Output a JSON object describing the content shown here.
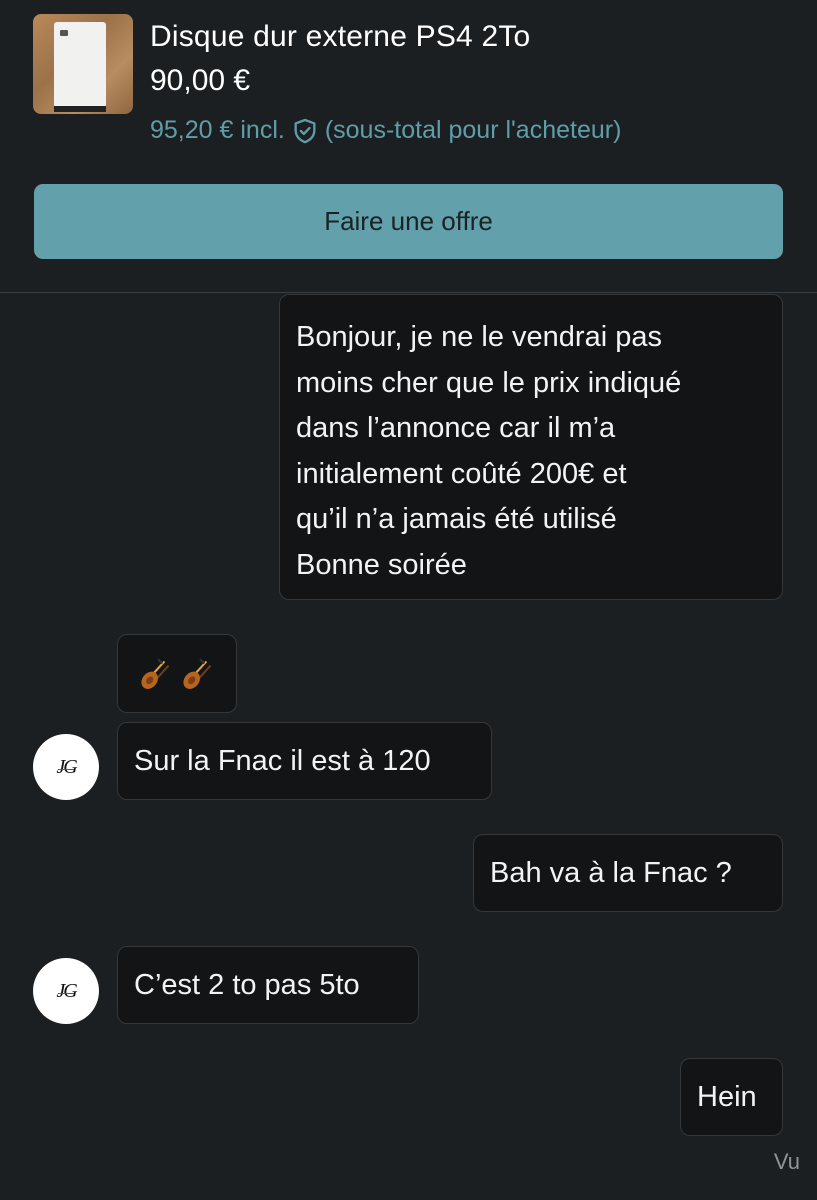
{
  "product": {
    "title": "Disque dur externe PS4 2To",
    "price": "90,00 €",
    "buyer_price": "95,20 € incl.",
    "buyer_note": "(sous-total pour l'acheteur)",
    "thumbnail_icon": "ps5-console-image",
    "accent_color": "#62a0ab"
  },
  "offer_button": {
    "label": "Faire une offre"
  },
  "messages": [
    {
      "sender": "me",
      "text": "Bonjour, je ne le vendrai pas\nmoins cher que le prix indiqué\ndans l’annonce car il m’a\ninitialement coûté 200€ et\nqu’il n’a jamais été utilisé\nBonne soirée"
    },
    {
      "sender": "other",
      "reaction_icons": [
        "violin-emoji",
        "violin-emoji"
      ]
    },
    {
      "sender": "other",
      "avatar": "JG",
      "text": "Sur la Fnac il est à 120"
    },
    {
      "sender": "me",
      "text": "Bah va à la Fnac ?"
    },
    {
      "sender": "other",
      "avatar": "JG",
      "text": "C’est 2 to pas 5to"
    },
    {
      "sender": "me",
      "text": "Hein"
    }
  ],
  "status": {
    "seen_label": "Vu"
  }
}
